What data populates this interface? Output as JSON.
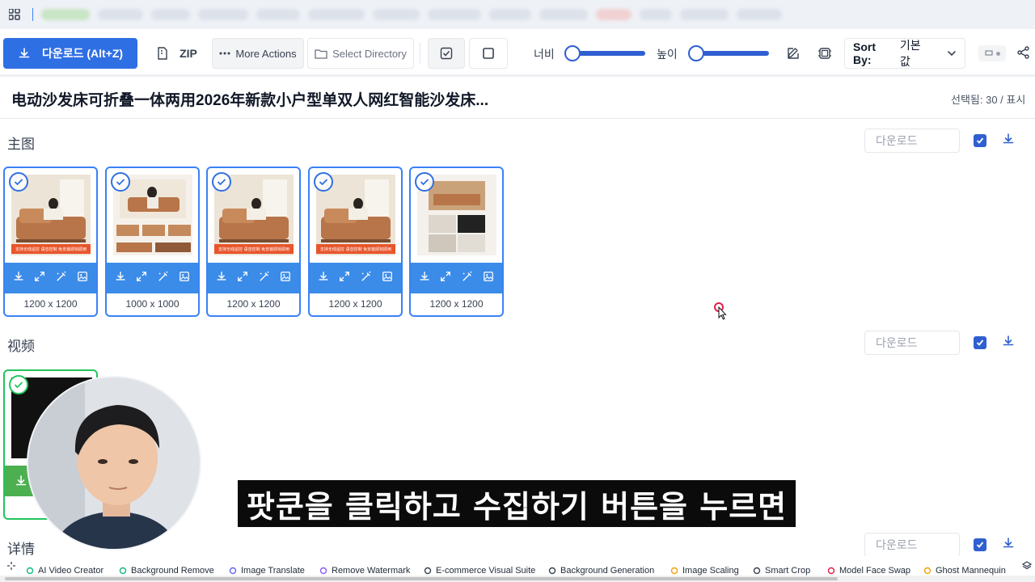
{
  "toolbar": {
    "download_label": "다운로드 (Alt+Z)",
    "zip_label": "ZIP",
    "more_actions_label": "More Actions",
    "select_directory_label": "Select Directory",
    "width_label": "너비",
    "height_label": "높이",
    "sort_prefix": "Sort By:",
    "sort_value": "기본값"
  },
  "header": {
    "title": "电动沙发床可折叠一体两用2026年新款小户型单双人网红智能沙发床...",
    "selected_info": "선택됨: 30 / 표시"
  },
  "sections": [
    {
      "label": "主图",
      "download_placeholder": "다운로드",
      "images": [
        {
          "size": "1200 x 1200",
          "promo_text": "支持无线遥控 语音控制 免安装即刻即用"
        },
        {
          "size": "1000 x 1000",
          "promo_text": ""
        },
        {
          "size": "1200 x 1200",
          "promo_text": "支持无线遥控 语音控制 免安装即刻即用"
        },
        {
          "size": "1200 x 1200",
          "promo_text": "支持无线遥控 语音控制 免安装即刻即用"
        },
        {
          "size": "1200 x 1200",
          "promo_text": ""
        }
      ]
    },
    {
      "label": "视频",
      "download_placeholder": "다운로드"
    },
    {
      "label": "详情",
      "download_placeholder": "다운로드"
    }
  ],
  "subtitle": "팟쿤을 클릭하고 수집하기 버튼을 누르면",
  "bottom_tools": [
    "AI Video Creator",
    "Background Remove",
    "Image Translate",
    "Remove Watermark",
    "E-commerce Visual Suite",
    "Background Generation",
    "Image Scaling",
    "Smart Crop",
    "Model Face Swap",
    "Ghost Mannequin"
  ],
  "colors": {
    "primary": "#2f6fe4",
    "action_bar": "#3b8be8",
    "video_accent": "#22c55e",
    "sofa": "#b87549",
    "promo_banner": "#e8552b"
  },
  "icons": {
    "download": "download-icon",
    "expand": "expand-icon",
    "magic": "magic-wand-icon",
    "image": "image-icon"
  }
}
